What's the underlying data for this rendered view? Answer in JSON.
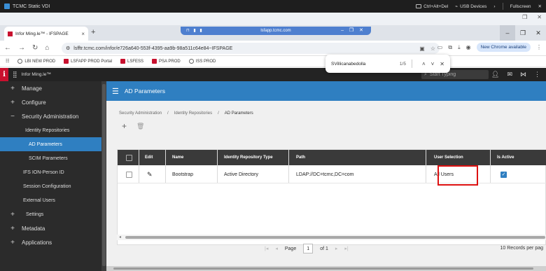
{
  "vdi": {
    "title": "TCMC Static VDI",
    "ctrl_alt_del": "Ctrl+Alt+Del",
    "usb_devices": "USB Devices",
    "fullscreen": "Fullscreen"
  },
  "browser": {
    "tab_title": "Infor Ming.le™ - IFSPAGE",
    "remote_host": "lsfapp.tcmc.com",
    "url": "lsfftr.tcmc.com/infor/e726a640-553f-4395-aa9b-98a511c64e84~IFSPAGE",
    "update_label": "New Chrome available",
    "bookmarks": [
      "LBI NEW PROD",
      "LSFAPP PROD Portal",
      "LSFESS",
      "PSA PROD",
      "ISS PROD"
    ]
  },
  "find_bar": {
    "query": "SVillicanabedolla",
    "count": "1/5"
  },
  "app": {
    "name": "Infor Ming.le™",
    "search_placeholder": "Start Typing"
  },
  "sidebar": {
    "items": [
      {
        "label": "Manage",
        "sign": "+"
      },
      {
        "label": "Configure",
        "sign": "+"
      },
      {
        "label": "Security Administration",
        "sign": "−"
      }
    ],
    "identity_repositories": "Identity Repositories",
    "identity_sign": "−",
    "ad_parameters": "AD Parameters",
    "scim_parameters": "SCIM Parameters",
    "ifs_ion_person_id": "IFS ION-Person ID",
    "session_configuration": "Session Configuration",
    "external_users": "External Users",
    "settings": "Settings",
    "metadata": "Metadata",
    "applications": "Applications"
  },
  "main": {
    "title": "AD Parameters",
    "breadcrumb": [
      "Security Administration",
      "/",
      "Identity Repositories",
      "/",
      "AD Parameters"
    ],
    "columns": {
      "edit": "Edit",
      "name": "Name",
      "repo_type": "Identity Repository Type",
      "path": "Path",
      "user_selection": "User Selection",
      "is_active": "Is Active"
    },
    "rows": [
      {
        "name": "Bootstrap",
        "repo_type": "Active Directory",
        "path": "LDAP://DC=tcmc,DC=com",
        "user_selection": "All Users",
        "is_active": true
      }
    ],
    "pager": {
      "page_label": "Page",
      "page": "1",
      "of_label": "of 1",
      "records": "10 Records per pag"
    }
  },
  "colors": {
    "accent": "#2f7fc1",
    "brand_red": "#c8102e",
    "header_dark": "#232323",
    "highlight": "#dd1111"
  }
}
